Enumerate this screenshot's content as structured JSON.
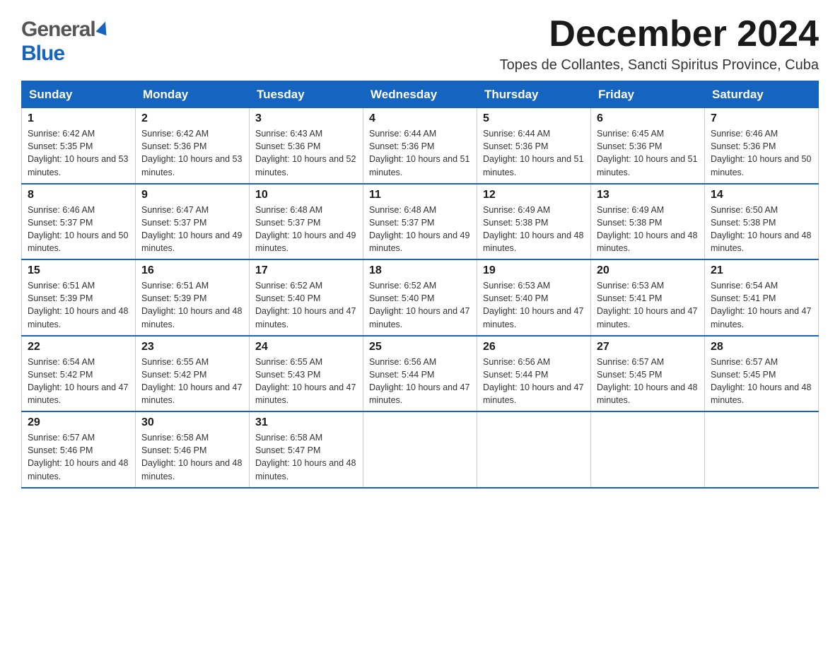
{
  "header": {
    "logo_general": "General",
    "logo_blue": "Blue",
    "month_title": "December 2024",
    "location": "Topes de Collantes, Sancti Spiritus Province, Cuba"
  },
  "calendar": {
    "days_of_week": [
      "Sunday",
      "Monday",
      "Tuesday",
      "Wednesday",
      "Thursday",
      "Friday",
      "Saturday"
    ],
    "weeks": [
      [
        {
          "day": "1",
          "sunrise": "6:42 AM",
          "sunset": "5:35 PM",
          "daylight": "10 hours and 53 minutes."
        },
        {
          "day": "2",
          "sunrise": "6:42 AM",
          "sunset": "5:36 PM",
          "daylight": "10 hours and 53 minutes."
        },
        {
          "day": "3",
          "sunrise": "6:43 AM",
          "sunset": "5:36 PM",
          "daylight": "10 hours and 52 minutes."
        },
        {
          "day": "4",
          "sunrise": "6:44 AM",
          "sunset": "5:36 PM",
          "daylight": "10 hours and 51 minutes."
        },
        {
          "day": "5",
          "sunrise": "6:44 AM",
          "sunset": "5:36 PM",
          "daylight": "10 hours and 51 minutes."
        },
        {
          "day": "6",
          "sunrise": "6:45 AM",
          "sunset": "5:36 PM",
          "daylight": "10 hours and 51 minutes."
        },
        {
          "day": "7",
          "sunrise": "6:46 AM",
          "sunset": "5:36 PM",
          "daylight": "10 hours and 50 minutes."
        }
      ],
      [
        {
          "day": "8",
          "sunrise": "6:46 AM",
          "sunset": "5:37 PM",
          "daylight": "10 hours and 50 minutes."
        },
        {
          "day": "9",
          "sunrise": "6:47 AM",
          "sunset": "5:37 PM",
          "daylight": "10 hours and 49 minutes."
        },
        {
          "day": "10",
          "sunrise": "6:48 AM",
          "sunset": "5:37 PM",
          "daylight": "10 hours and 49 minutes."
        },
        {
          "day": "11",
          "sunrise": "6:48 AM",
          "sunset": "5:37 PM",
          "daylight": "10 hours and 49 minutes."
        },
        {
          "day": "12",
          "sunrise": "6:49 AM",
          "sunset": "5:38 PM",
          "daylight": "10 hours and 48 minutes."
        },
        {
          "day": "13",
          "sunrise": "6:49 AM",
          "sunset": "5:38 PM",
          "daylight": "10 hours and 48 minutes."
        },
        {
          "day": "14",
          "sunrise": "6:50 AM",
          "sunset": "5:38 PM",
          "daylight": "10 hours and 48 minutes."
        }
      ],
      [
        {
          "day": "15",
          "sunrise": "6:51 AM",
          "sunset": "5:39 PM",
          "daylight": "10 hours and 48 minutes."
        },
        {
          "day": "16",
          "sunrise": "6:51 AM",
          "sunset": "5:39 PM",
          "daylight": "10 hours and 48 minutes."
        },
        {
          "day": "17",
          "sunrise": "6:52 AM",
          "sunset": "5:40 PM",
          "daylight": "10 hours and 47 minutes."
        },
        {
          "day": "18",
          "sunrise": "6:52 AM",
          "sunset": "5:40 PM",
          "daylight": "10 hours and 47 minutes."
        },
        {
          "day": "19",
          "sunrise": "6:53 AM",
          "sunset": "5:40 PM",
          "daylight": "10 hours and 47 minutes."
        },
        {
          "day": "20",
          "sunrise": "6:53 AM",
          "sunset": "5:41 PM",
          "daylight": "10 hours and 47 minutes."
        },
        {
          "day": "21",
          "sunrise": "6:54 AM",
          "sunset": "5:41 PM",
          "daylight": "10 hours and 47 minutes."
        }
      ],
      [
        {
          "day": "22",
          "sunrise": "6:54 AM",
          "sunset": "5:42 PM",
          "daylight": "10 hours and 47 minutes."
        },
        {
          "day": "23",
          "sunrise": "6:55 AM",
          "sunset": "5:42 PM",
          "daylight": "10 hours and 47 minutes."
        },
        {
          "day": "24",
          "sunrise": "6:55 AM",
          "sunset": "5:43 PM",
          "daylight": "10 hours and 47 minutes."
        },
        {
          "day": "25",
          "sunrise": "6:56 AM",
          "sunset": "5:44 PM",
          "daylight": "10 hours and 47 minutes."
        },
        {
          "day": "26",
          "sunrise": "6:56 AM",
          "sunset": "5:44 PM",
          "daylight": "10 hours and 47 minutes."
        },
        {
          "day": "27",
          "sunrise": "6:57 AM",
          "sunset": "5:45 PM",
          "daylight": "10 hours and 48 minutes."
        },
        {
          "day": "28",
          "sunrise": "6:57 AM",
          "sunset": "5:45 PM",
          "daylight": "10 hours and 48 minutes."
        }
      ],
      [
        {
          "day": "29",
          "sunrise": "6:57 AM",
          "sunset": "5:46 PM",
          "daylight": "10 hours and 48 minutes."
        },
        {
          "day": "30",
          "sunrise": "6:58 AM",
          "sunset": "5:46 PM",
          "daylight": "10 hours and 48 minutes."
        },
        {
          "day": "31",
          "sunrise": "6:58 AM",
          "sunset": "5:47 PM",
          "daylight": "10 hours and 48 minutes."
        },
        null,
        null,
        null,
        null
      ]
    ]
  }
}
